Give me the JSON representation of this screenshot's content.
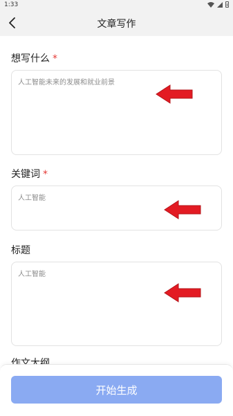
{
  "status_bar": {
    "time": "1:33"
  },
  "nav": {
    "title": "文章写作"
  },
  "form": {
    "topic_label": "想写什么",
    "topic_value": "人工智能未来的发展和就业前景",
    "keywords_label": "关键词",
    "keywords_value": "人工智能",
    "title_label": "标题",
    "title_value": "人工智能",
    "outline_label": "作文大纲",
    "required_mark": "*"
  },
  "footer": {
    "start_button_label": "开始生成"
  },
  "colors": {
    "accent": "#8aaaf2",
    "required": "#e53935",
    "arrow": "#e31b23"
  }
}
